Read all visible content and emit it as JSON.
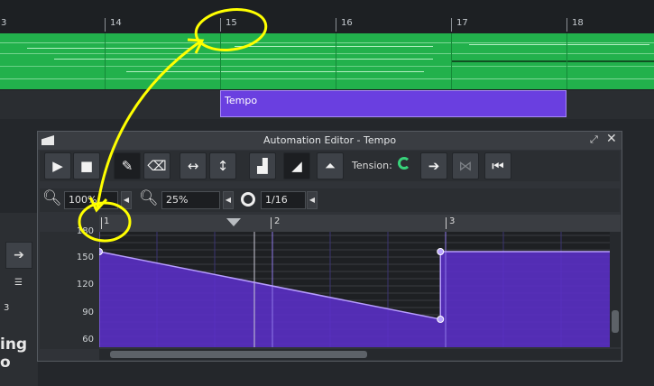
{
  "timeline": {
    "bars": [
      "3",
      "14",
      "15",
      "16",
      "17",
      "18"
    ]
  },
  "tempo_pattern": {
    "label": "Tempo"
  },
  "side": {
    "text_fragment": "ing o",
    "number": "3"
  },
  "editor": {
    "title": "Automation Editor - Tempo",
    "tension_label": "Tension:",
    "zoom_x": "100%",
    "zoom_y": "25%",
    "quantize": "1/16",
    "ruler_labels": [
      "1",
      "2",
      "3"
    ],
    "y_labels": [
      "180",
      "150",
      "120",
      "90",
      "60"
    ]
  },
  "chart_data": {
    "type": "line",
    "y_ticks": [
      150,
      120,
      90,
      60
    ],
    "points": [
      {
        "x": 1.0,
        "y": 157
      },
      {
        "x": 2.97,
        "y": 82
      },
      {
        "x": 2.97,
        "y": 157
      }
    ],
    "x_ticks": [
      "1",
      "2",
      "3"
    ]
  },
  "colors": {
    "accent": "#6a3fe0",
    "track": "#22b14c",
    "annotation": "#ffff00",
    "tension_icon": "#37d37a"
  }
}
